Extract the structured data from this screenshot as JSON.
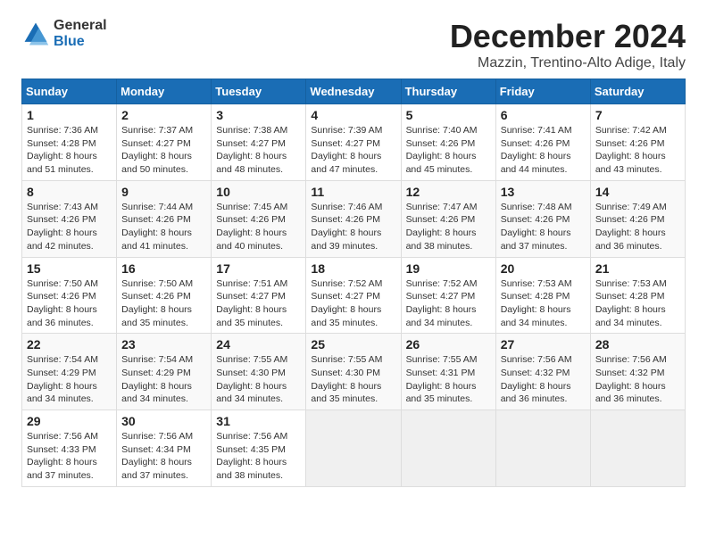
{
  "logo": {
    "general": "General",
    "blue": "Blue"
  },
  "header": {
    "title": "December 2024",
    "subtitle": "Mazzin, Trentino-Alto Adige, Italy"
  },
  "weekdays": [
    "Sunday",
    "Monday",
    "Tuesday",
    "Wednesday",
    "Thursday",
    "Friday",
    "Saturday"
  ],
  "weeks": [
    [
      {
        "day": "1",
        "info": "Sunrise: 7:36 AM\nSunset: 4:28 PM\nDaylight: 8 hours\nand 51 minutes."
      },
      {
        "day": "2",
        "info": "Sunrise: 7:37 AM\nSunset: 4:27 PM\nDaylight: 8 hours\nand 50 minutes."
      },
      {
        "day": "3",
        "info": "Sunrise: 7:38 AM\nSunset: 4:27 PM\nDaylight: 8 hours\nand 48 minutes."
      },
      {
        "day": "4",
        "info": "Sunrise: 7:39 AM\nSunset: 4:27 PM\nDaylight: 8 hours\nand 47 minutes."
      },
      {
        "day": "5",
        "info": "Sunrise: 7:40 AM\nSunset: 4:26 PM\nDaylight: 8 hours\nand 45 minutes."
      },
      {
        "day": "6",
        "info": "Sunrise: 7:41 AM\nSunset: 4:26 PM\nDaylight: 8 hours\nand 44 minutes."
      },
      {
        "day": "7",
        "info": "Sunrise: 7:42 AM\nSunset: 4:26 PM\nDaylight: 8 hours\nand 43 minutes."
      }
    ],
    [
      {
        "day": "8",
        "info": "Sunrise: 7:43 AM\nSunset: 4:26 PM\nDaylight: 8 hours\nand 42 minutes."
      },
      {
        "day": "9",
        "info": "Sunrise: 7:44 AM\nSunset: 4:26 PM\nDaylight: 8 hours\nand 41 minutes."
      },
      {
        "day": "10",
        "info": "Sunrise: 7:45 AM\nSunset: 4:26 PM\nDaylight: 8 hours\nand 40 minutes."
      },
      {
        "day": "11",
        "info": "Sunrise: 7:46 AM\nSunset: 4:26 PM\nDaylight: 8 hours\nand 39 minutes."
      },
      {
        "day": "12",
        "info": "Sunrise: 7:47 AM\nSunset: 4:26 PM\nDaylight: 8 hours\nand 38 minutes."
      },
      {
        "day": "13",
        "info": "Sunrise: 7:48 AM\nSunset: 4:26 PM\nDaylight: 8 hours\nand 37 minutes."
      },
      {
        "day": "14",
        "info": "Sunrise: 7:49 AM\nSunset: 4:26 PM\nDaylight: 8 hours\nand 36 minutes."
      }
    ],
    [
      {
        "day": "15",
        "info": "Sunrise: 7:50 AM\nSunset: 4:26 PM\nDaylight: 8 hours\nand 36 minutes."
      },
      {
        "day": "16",
        "info": "Sunrise: 7:50 AM\nSunset: 4:26 PM\nDaylight: 8 hours\nand 35 minutes."
      },
      {
        "day": "17",
        "info": "Sunrise: 7:51 AM\nSunset: 4:27 PM\nDaylight: 8 hours\nand 35 minutes."
      },
      {
        "day": "18",
        "info": "Sunrise: 7:52 AM\nSunset: 4:27 PM\nDaylight: 8 hours\nand 35 minutes."
      },
      {
        "day": "19",
        "info": "Sunrise: 7:52 AM\nSunset: 4:27 PM\nDaylight: 8 hours\nand 34 minutes."
      },
      {
        "day": "20",
        "info": "Sunrise: 7:53 AM\nSunset: 4:28 PM\nDaylight: 8 hours\nand 34 minutes."
      },
      {
        "day": "21",
        "info": "Sunrise: 7:53 AM\nSunset: 4:28 PM\nDaylight: 8 hours\nand 34 minutes."
      }
    ],
    [
      {
        "day": "22",
        "info": "Sunrise: 7:54 AM\nSunset: 4:29 PM\nDaylight: 8 hours\nand 34 minutes."
      },
      {
        "day": "23",
        "info": "Sunrise: 7:54 AM\nSunset: 4:29 PM\nDaylight: 8 hours\nand 34 minutes."
      },
      {
        "day": "24",
        "info": "Sunrise: 7:55 AM\nSunset: 4:30 PM\nDaylight: 8 hours\nand 34 minutes."
      },
      {
        "day": "25",
        "info": "Sunrise: 7:55 AM\nSunset: 4:30 PM\nDaylight: 8 hours\nand 35 minutes."
      },
      {
        "day": "26",
        "info": "Sunrise: 7:55 AM\nSunset: 4:31 PM\nDaylight: 8 hours\nand 35 minutes."
      },
      {
        "day": "27",
        "info": "Sunrise: 7:56 AM\nSunset: 4:32 PM\nDaylight: 8 hours\nand 36 minutes."
      },
      {
        "day": "28",
        "info": "Sunrise: 7:56 AM\nSunset: 4:32 PM\nDaylight: 8 hours\nand 36 minutes."
      }
    ],
    [
      {
        "day": "29",
        "info": "Sunrise: 7:56 AM\nSunset: 4:33 PM\nDaylight: 8 hours\nand 37 minutes."
      },
      {
        "day": "30",
        "info": "Sunrise: 7:56 AM\nSunset: 4:34 PM\nDaylight: 8 hours\nand 37 minutes."
      },
      {
        "day": "31",
        "info": "Sunrise: 7:56 AM\nSunset: 4:35 PM\nDaylight: 8 hours\nand 38 minutes."
      },
      {
        "day": "",
        "info": ""
      },
      {
        "day": "",
        "info": ""
      },
      {
        "day": "",
        "info": ""
      },
      {
        "day": "",
        "info": ""
      }
    ]
  ]
}
